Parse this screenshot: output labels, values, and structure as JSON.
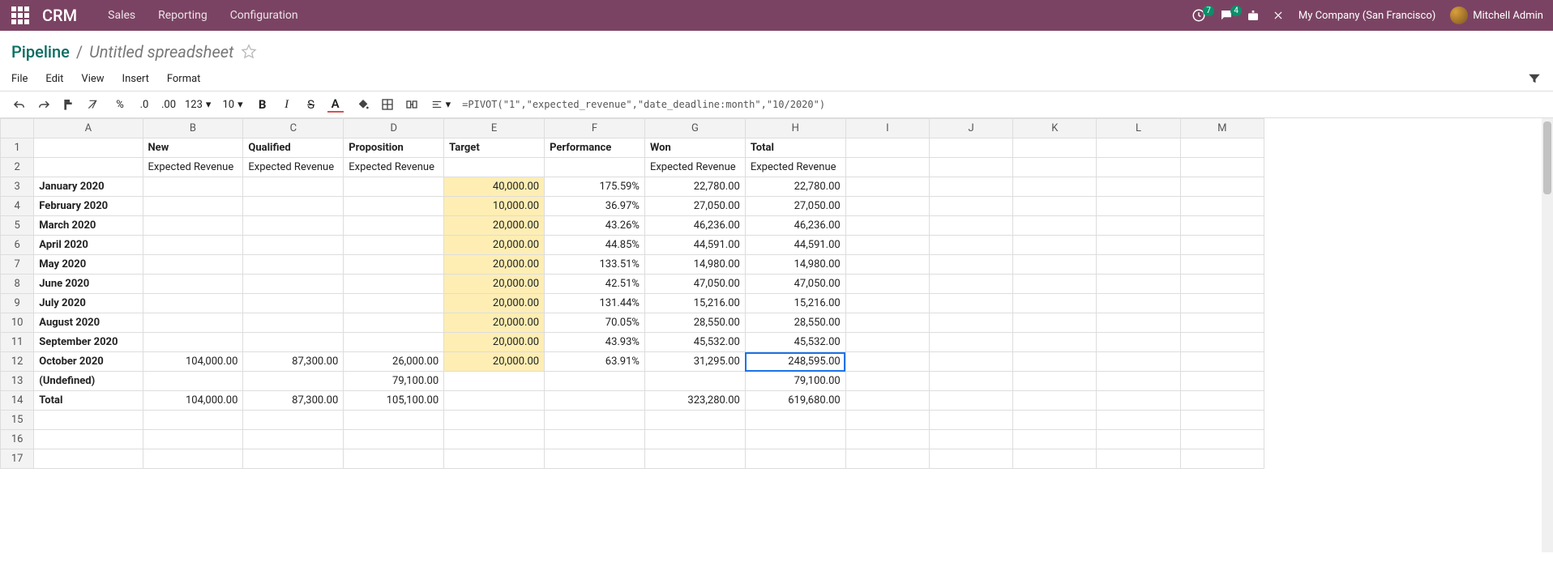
{
  "topbar": {
    "brand": "CRM",
    "menu": [
      "Sales",
      "Reporting",
      "Configuration"
    ],
    "clock_badge": "7",
    "chat_badge": "4",
    "company": "My Company (San Francisco)",
    "user": "Mitchell Admin"
  },
  "breadcrumb": {
    "root": "Pipeline",
    "title": "Untitled spreadsheet"
  },
  "menubar": [
    "File",
    "Edit",
    "View",
    "Insert",
    "Format"
  ],
  "toolbar": {
    "pct": "%",
    "d0": ".0",
    "d00": ".00",
    "fmt": "123",
    "font_size": "10",
    "bold": "B",
    "italic": "I",
    "strike": "S",
    "color": "A"
  },
  "formula": "=PIVOT(\"1\",\"expected_revenue\",\"date_deadline:month\",\"10/2020\")",
  "columns": [
    "A",
    "B",
    "C",
    "D",
    "E",
    "F",
    "G",
    "H",
    "I",
    "J",
    "K",
    "L",
    "M"
  ],
  "headers1": {
    "B": "New",
    "C": "Qualified",
    "D": "Proposition",
    "E": "Target",
    "F": "Performance",
    "G": "Won",
    "H": "Total"
  },
  "headers2": {
    "B": "Expected Revenue",
    "C": "Expected Revenue",
    "D": "Expected Revenue",
    "G": "Expected Revenue",
    "H": "Expected Revenue"
  },
  "rows": [
    {
      "n": 3,
      "A": "January 2020",
      "E": "40,000.00",
      "F": "175.59%",
      "G": "22,780.00",
      "H": "22,780.00"
    },
    {
      "n": 4,
      "A": "February 2020",
      "E": "10,000.00",
      "F": "36.97%",
      "G": "27,050.00",
      "H": "27,050.00"
    },
    {
      "n": 5,
      "A": "March 2020",
      "E": "20,000.00",
      "F": "43.26%",
      "G": "46,236.00",
      "H": "46,236.00"
    },
    {
      "n": 6,
      "A": "April 2020",
      "E": "20,000.00",
      "F": "44.85%",
      "G": "44,591.00",
      "H": "44,591.00"
    },
    {
      "n": 7,
      "A": "May 2020",
      "E": "20,000.00",
      "F": "133.51%",
      "G": "14,980.00",
      "H": "14,980.00"
    },
    {
      "n": 8,
      "A": "June 2020",
      "E": "20,000.00",
      "F": "42.51%",
      "G": "47,050.00",
      "H": "47,050.00"
    },
    {
      "n": 9,
      "A": "July 2020",
      "E": "20,000.00",
      "F": "131.44%",
      "G": "15,216.00",
      "H": "15,216.00"
    },
    {
      "n": 10,
      "A": "August 2020",
      "E": "20,000.00",
      "F": "70.05%",
      "G": "28,550.00",
      "H": "28,550.00"
    },
    {
      "n": 11,
      "A": "September 2020",
      "E": "20,000.00",
      "F": "43.93%",
      "G": "45,532.00",
      "H": "45,532.00"
    },
    {
      "n": 12,
      "A": "October 2020",
      "B": "104,000.00",
      "C": "87,300.00",
      "D": "26,000.00",
      "E": "20,000.00",
      "F": "63.91%",
      "G": "31,295.00",
      "H": "248,595.00",
      "sel": true
    },
    {
      "n": 13,
      "A": "(Undefined)",
      "D": "79,100.00",
      "H": "79,100.00"
    },
    {
      "n": 14,
      "A": "Total",
      "B": "104,000.00",
      "C": "87,300.00",
      "D": "105,100.00",
      "G": "323,280.00",
      "H": "619,680.00"
    },
    {
      "n": 15
    },
    {
      "n": 16
    },
    {
      "n": 17
    }
  ]
}
